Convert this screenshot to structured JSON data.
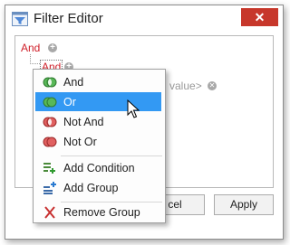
{
  "window": {
    "title": "Filter Editor",
    "close_label": "✕"
  },
  "tree": {
    "root_group": "And",
    "child_group": "And",
    "value_placeholder": "value>"
  },
  "buttons": {
    "cancel_label": "cel",
    "apply_label": "Apply"
  },
  "menu": {
    "items": [
      {
        "label": "And",
        "icon": "and-group-icon",
        "color": "#3c9a3c"
      },
      {
        "label": "Or",
        "icon": "or-group-icon",
        "color": "#3c9a3c",
        "selected": true
      },
      {
        "label": "Not And",
        "icon": "not-and-group-icon",
        "color": "#d04040"
      },
      {
        "label": "Not Or",
        "icon": "not-or-group-icon",
        "color": "#d04040"
      },
      {
        "label": "Add Condition",
        "icon": "add-condition-icon"
      },
      {
        "label": "Add Group",
        "icon": "add-group-icon"
      },
      {
        "label": "Remove Group",
        "icon": "remove-group-icon"
      }
    ]
  },
  "colors": {
    "accent": "#3399f3",
    "group_text": "#d0202a",
    "close": "#c7372b"
  }
}
